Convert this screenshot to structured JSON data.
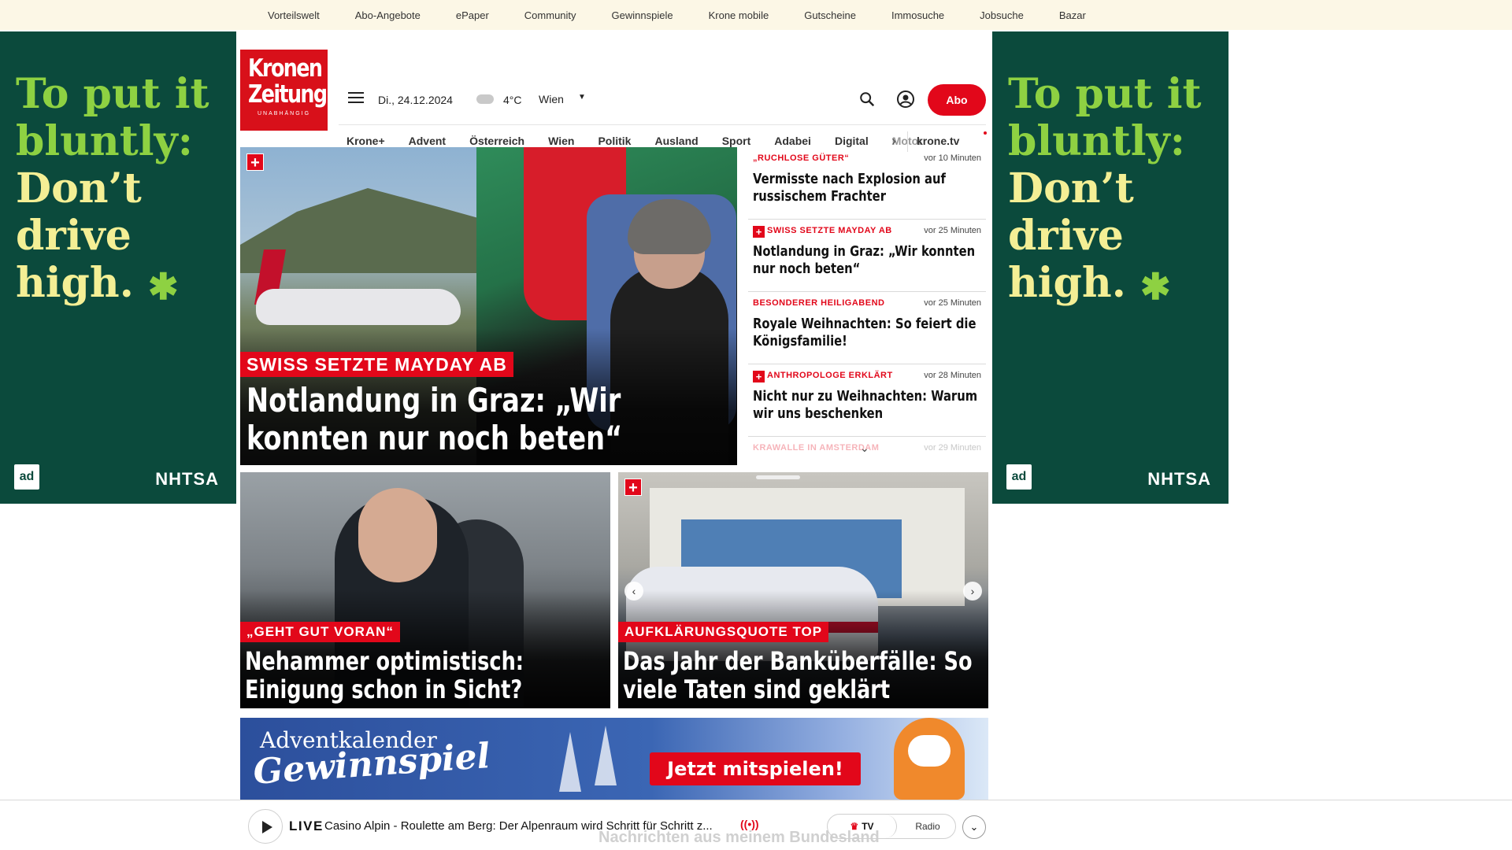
{
  "topnav": {
    "items": [
      "Vorteilswelt",
      "Abo-Angebote",
      "ePaper",
      "Community",
      "Gewinnspiele",
      "Krone mobile",
      "Gutscheine",
      "Immosuche",
      "Jobsuche",
      "Bazar"
    ]
  },
  "ad": {
    "line1": "To put it bluntly:",
    "line2": "Don’t drive high.",
    "ad_logo": "ad",
    "sponsor_small": "NHTSA",
    "sponsor": "NHTSA",
    "leaf_icon": "cannabis-leaf-icon"
  },
  "header": {
    "logo_line1": "Kronen",
    "logo_line2": "Zeitung",
    "logo_tagline": "UNABHÄNGIG",
    "date": "Di., 24.12.2024",
    "temperature": "4°C",
    "city": "Wien",
    "abo_label": "Abo",
    "brand_color": "#e2071a"
  },
  "nav": {
    "tabs": [
      "Krone+",
      "Advent",
      "Österreich",
      "Wien",
      "Politik",
      "Ausland",
      "Sport",
      "Adabei",
      "Digital",
      "Motor"
    ],
    "krone_tv": "krone.tv"
  },
  "hero": {
    "kicker": "SWISS SETZTE MAYDAY AB",
    "headline": "Notlandung in Graz: „Wir konnten nur noch beten“",
    "plus": "+"
  },
  "ticker": [
    {
      "kicker": "„RUCHLOSE GÜTER“",
      "time": "vor 10 Minuten",
      "title": "Vermisste nach Explosion auf russischem Frachter",
      "plus": false
    },
    {
      "kicker": "SWISS SETZTE MAYDAY AB",
      "time": "vor 25 Minuten",
      "title": "Notlandung in Graz: „Wir konnten nur noch beten“",
      "plus": true
    },
    {
      "kicker": "BESONDERER HEILIGABEND",
      "time": "vor 25 Minuten",
      "title": "Royale Weihnachten: So feiert die Königsfamilie!",
      "plus": false
    },
    {
      "kicker": "ANTHROPOLOGE ERKLÄRT",
      "time": "vor 28 Minuten",
      "title": "Nicht nur zu Weihnachten: Warum wir uns beschenken",
      "plus": true
    },
    {
      "kicker": "KRAWALLE IN AMSTERDAM",
      "time": "vor 29 Minuten",
      "title": "",
      "plus": false
    }
  ],
  "teasers": [
    {
      "kicker": "„GEHT GUT VORAN“",
      "headline": "Nehammer optimistisch: Einigung schon in Sicht?"
    },
    {
      "kicker": "AUFKLÄRUNGSQUOTE TOP",
      "headline": "Das Jahr der Banküberfälle: So viele Taten sind geklärt"
    }
  ],
  "banner": {
    "title": "Adventkalender",
    "subtitle": "Gewinnspiel",
    "cta": "Jetzt mitspielen!"
  },
  "player": {
    "live_label": "LIVE",
    "title": "Casino Alpin - Roulette am Berg: Der Alpenraum wird Schritt für Schritt z...",
    "tv_label": "TV",
    "radio_label": "Radio",
    "below_text": "Nachrichten aus meinem Bundesland"
  }
}
